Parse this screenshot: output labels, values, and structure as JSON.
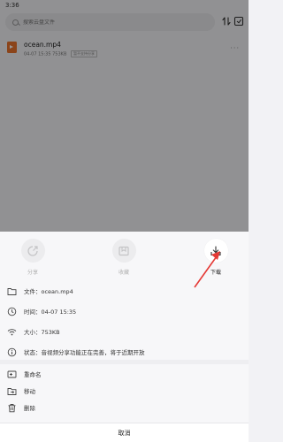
{
  "status_bar": {
    "time": "3:36"
  },
  "search": {
    "placeholder": "搜索云盘文件"
  },
  "file": {
    "name": "ocean.mp4",
    "date": "04-07 15:35",
    "size": "753KB",
    "tag": "暂不支持分享",
    "more": "···"
  },
  "actions": [
    {
      "label": "分享",
      "icon": "share-icon",
      "enabled": false
    },
    {
      "label": "收藏",
      "icon": "bookmark-icon",
      "enabled": false
    },
    {
      "label": "下载",
      "icon": "download-icon",
      "enabled": true
    }
  ],
  "info": {
    "file_name": "文件：ocean.mp4",
    "time": "时间：04-07 15:35",
    "size": "大小：753KB",
    "status": "状态：音视频分享功能正在完善，将于近期开放"
  },
  "operations": [
    {
      "label": "重命名",
      "icon": "rename-icon"
    },
    {
      "label": "移动",
      "icon": "move-icon"
    },
    {
      "label": "删除",
      "icon": "delete-icon"
    }
  ],
  "cancel_label": "取消",
  "colors": {
    "accent_arrow": "#e53935",
    "file_icon": "#e8722c",
    "dim": "rgba(0,0,0,0.4)"
  }
}
